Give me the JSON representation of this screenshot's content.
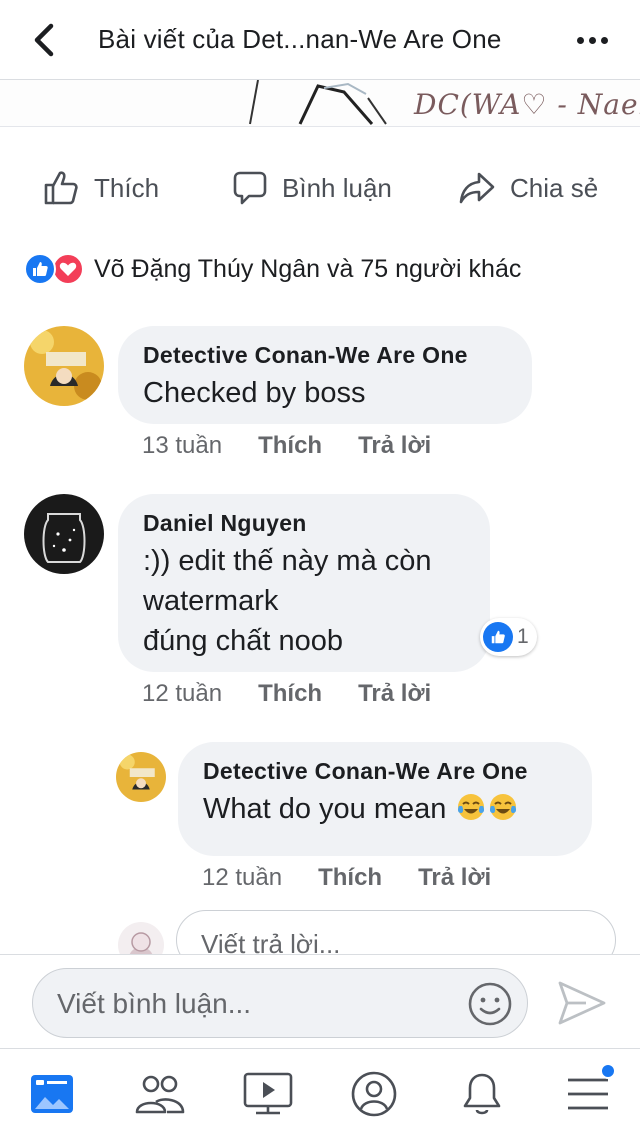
{
  "header": {
    "title": "Bài viết của Det...nan-We Are One",
    "back_icon": "chevron-left-icon",
    "more_icon": "more-horizontal-icon"
  },
  "post_image": {
    "signature_text": "DC(WA♡ - Naeko"
  },
  "actions": {
    "like_label": "Thích",
    "comment_label": "Bình luận",
    "share_label": "Chia sẻ"
  },
  "reactions_summary": {
    "text": "Võ Đặng Thúy Ngân và 75 người khác",
    "icons": [
      "like-reaction-icon",
      "love-reaction-icon"
    ]
  },
  "comments": [
    {
      "author": "Detective Conan-We Are One",
      "text": "Checked by boss",
      "time": "13 tuần",
      "like_label": "Thích",
      "reply_label": "Trả lời"
    },
    {
      "author": "Daniel Nguyen",
      "lines": [
        ":)) edit thế này mà còn",
        "watermark",
        "đúng chất noob"
      ],
      "time": "12 tuần",
      "like_label": "Thích",
      "reply_label": "Trả lời",
      "reaction_count": "1"
    }
  ],
  "replies": [
    {
      "author": "Detective Conan-We Are One",
      "text": "What do you mean",
      "emoji": [
        "tears-of-joy-icon",
        "tears-of-joy-icon"
      ],
      "time": "12 tuần",
      "like_label": "Thích",
      "reply_label": "Trả lời"
    }
  ],
  "reply_input": {
    "placeholder": "Viết trả lời..."
  },
  "composer": {
    "placeholder": "Viết bình luận...",
    "emoji_icon": "smiley-icon",
    "send_icon": "send-icon"
  },
  "tabbar": {
    "tabs": [
      "news-feed-icon",
      "friends-icon",
      "watch-icon",
      "profile-icon",
      "notifications-icon",
      "menu-icon"
    ]
  },
  "colors": {
    "accent": "#1877f2",
    "love": "#f33e58",
    "bubble": "#f0f2f5",
    "secondary_text": "#65676b"
  }
}
